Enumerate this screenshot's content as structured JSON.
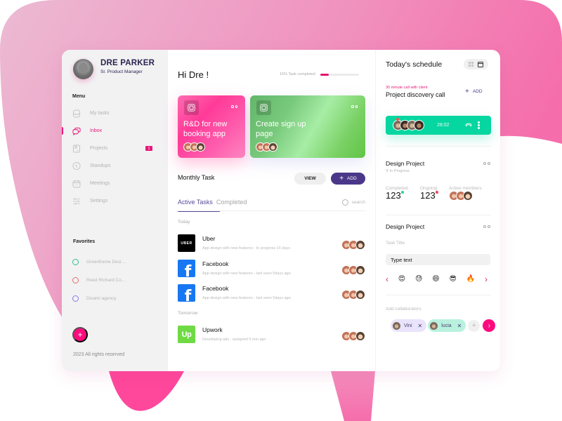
{
  "profile": {
    "name": "DRE PARKER",
    "role": "Sr. Product Manager"
  },
  "sidebar": {
    "menu_title": "Menu",
    "items": [
      {
        "label": "My tasks",
        "icon": "tasks-icon",
        "active": false
      },
      {
        "label": "Inbox",
        "icon": "inbox-icon",
        "active": true
      },
      {
        "label": "Projects",
        "icon": "projects-icon",
        "active": false,
        "badge": "1"
      },
      {
        "label": "Standups",
        "icon": "clock-icon",
        "active": false
      },
      {
        "label": "Meetings",
        "icon": "calendar-icon",
        "active": false
      },
      {
        "label": "Settings",
        "icon": "sliders-icon",
        "active": false
      }
    ],
    "favorites_title": "Favorites",
    "favorites": [
      {
        "label": "Greenframe Desi....",
        "color": "#2fbf8a"
      },
      {
        "label": "Reed Richard Co...",
        "color": "#ee6b6b"
      },
      {
        "label": "Divami agency",
        "color": "#8a7be0"
      }
    ],
    "fab_label": "+",
    "copyright": "2023 All rights reserved"
  },
  "main": {
    "greeting": "Hi Dre !",
    "progress": {
      "label": "15% Task completed",
      "percent": 15,
      "color": "#e6126f"
    },
    "cards": [
      {
        "title_line1": "R&D for new",
        "title_line2": "booking app",
        "theme": "pink"
      },
      {
        "title_line1": "Create sign up",
        "title_line2": "page",
        "theme": "green"
      }
    ],
    "monthly_title": "Monthly Task",
    "view_label": "VIEW",
    "add_label": "ADD",
    "tabs": [
      {
        "label": "Active Tasks",
        "active": true
      },
      {
        "label": "Completed",
        "active": false
      }
    ],
    "search_placeholder": "search",
    "groups": [
      {
        "label": "Today",
        "tasks": [
          {
            "name": "Uber",
            "logo_text": "UBER",
            "desc": "App design with new features - In progress 16 days"
          },
          {
            "name": "Facebook",
            "logo_text": "f",
            "desc": "App design with new features - last seen 5days ago."
          },
          {
            "name": "Facebook",
            "logo_text": "f",
            "desc": "App design with new features - last seen 5days ago."
          }
        ]
      },
      {
        "label": "Tomorrow",
        "tasks": [
          {
            "name": "Upwork",
            "logo_text": "Up",
            "desc": "Developing ads - assigned 5 min ago"
          }
        ]
      }
    ]
  },
  "schedule": {
    "title": "Today's schedule",
    "call_subtitle": "30 minute call with client",
    "call_title": "Project discovery call",
    "add_label": "ADD",
    "call_timer": "28:02",
    "call_color": "#06d6a0"
  },
  "project1": {
    "title": "Design Project",
    "status": "In Progress",
    "completed_label": "Completed",
    "completed_value": "123",
    "ongoing_label": "Ongoing",
    "ongoing_value": "123",
    "members_label": "Active members"
  },
  "project2": {
    "title": "Design Project",
    "task_title_label": "Task Title",
    "task_input_value": "Type text",
    "emojis": [
      "😍",
      "😓",
      "😄",
      "😎",
      "🔥"
    ],
    "collab_label": "Add collaborators",
    "collaborators": [
      {
        "name": "Vini"
      },
      {
        "name": "lucia"
      }
    ],
    "add_symbol": "+",
    "remove_symbol": "✕",
    "next_symbol": "›",
    "prev_symbol": "‹"
  },
  "colors": {
    "accent_pink": "#ff0a7e",
    "accent_purple": "#4a3789",
    "success": "#06d6a0"
  }
}
